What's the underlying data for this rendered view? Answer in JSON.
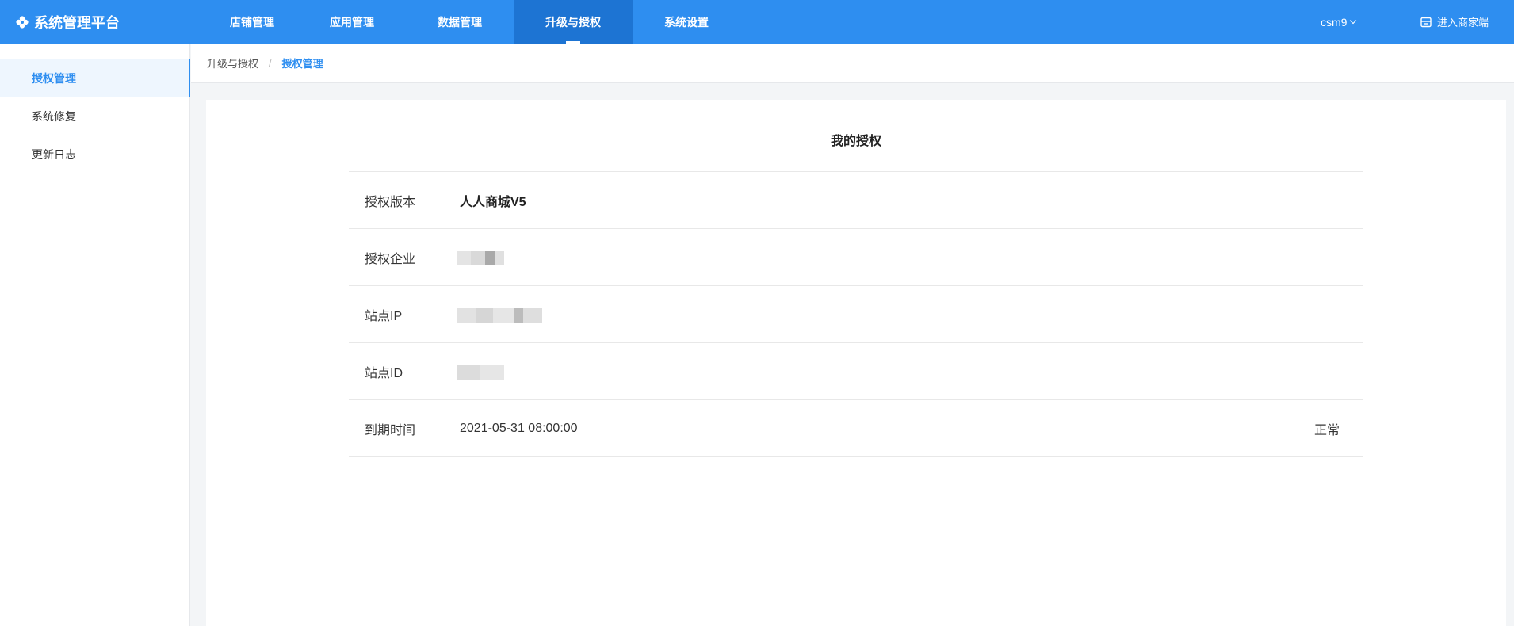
{
  "app": {
    "title": "系统管理平台",
    "logo_icon": "flower-icon"
  },
  "nav": {
    "tabs": [
      {
        "label": "店铺管理",
        "active": false
      },
      {
        "label": "应用管理",
        "active": false
      },
      {
        "label": "数据管理",
        "active": false
      },
      {
        "label": "升级与授权",
        "active": true
      },
      {
        "label": "系统设置",
        "active": false
      }
    ],
    "user": "csm9",
    "merchant_link": "进入商家端"
  },
  "sidebar": {
    "items": [
      {
        "label": "授权管理",
        "active": true
      },
      {
        "label": "系统修复",
        "active": false
      },
      {
        "label": "更新日志",
        "active": false
      }
    ]
  },
  "breadcrumb": {
    "parent": "升级与授权",
    "separator": "/",
    "current": "授权管理"
  },
  "license": {
    "title": "我的授权",
    "rows": [
      {
        "label": "授权版本",
        "value": "人人商城V5"
      },
      {
        "label": "授权企业",
        "value": ""
      },
      {
        "label": "站点IP",
        "value": ""
      },
      {
        "label": "站点ID",
        "value": ""
      },
      {
        "label": "到期时间",
        "value": "2021-05-31 08:00:00",
        "status": "正常"
      }
    ]
  },
  "colors": {
    "primary": "#2e8ef0",
    "nav_active": "#1d74d3",
    "sidebar_active_bg": "#eef6fe"
  }
}
